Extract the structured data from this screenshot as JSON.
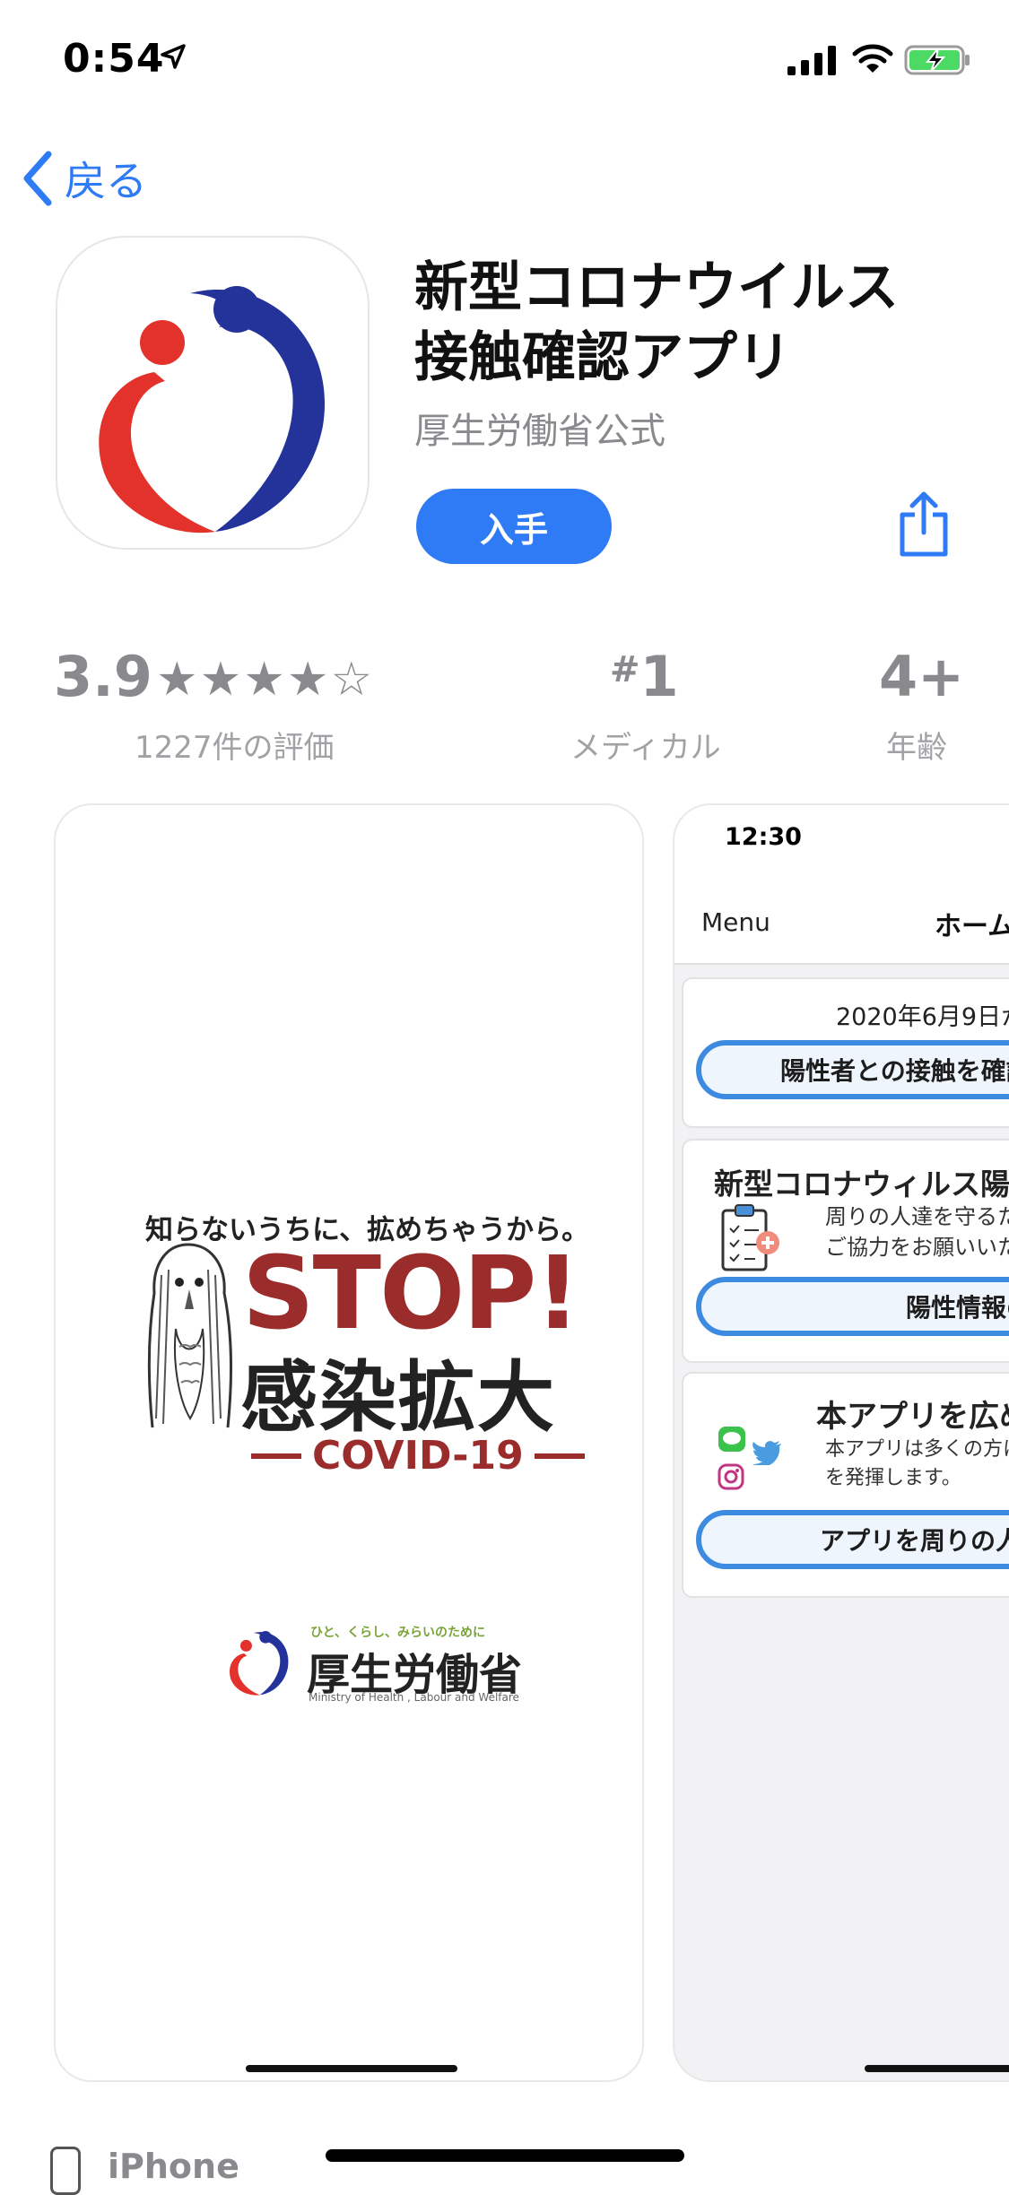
{
  "status_bar": {
    "time": "0:54",
    "icons": [
      "location-arrow-icon",
      "signal-bars-icon",
      "wifi-icon",
      "battery-charging-icon"
    ],
    "battery_color": "#4cd964"
  },
  "nav": {
    "back_label": "戻る"
  },
  "app": {
    "title_line1": "新型コロナウイルス",
    "title_line2": "接触確認アプリ",
    "subtitle": "厚生労働省公式",
    "get_label": "入手",
    "accent_color": "#2f7bf5"
  },
  "ratings": {
    "score": "3.9",
    "stars_display": "★★★★☆",
    "stars_value": 3.9,
    "count_label": "1227件の評価",
    "rank_hash": "#",
    "rank_value": "1",
    "rank_label": "メディカル",
    "age_value": "4+",
    "age_label": "年齢"
  },
  "screenshot1": {
    "tagline": "知らないうちに、拡めちゃうから。",
    "stop": "STOP!",
    "kanji": "感染拡大",
    "covid": "COVID-19",
    "org_tagline": "ひと、くらし、みらいのために",
    "org_name": "厚生労働省",
    "org_english": "Ministry of Health , Labour and Welfare"
  },
  "screenshot2": {
    "time": "12:30",
    "menu": "Menu",
    "home": "ホーム",
    "card1": {
      "date": "2020年6月9日か",
      "button": "陽性者との接触を確認"
    },
    "card2": {
      "title": "新型コロナウィルス陽性",
      "line1": "周りの人達を守るため",
      "line2": "ご協力をお願いいたし",
      "button": "陽性情報の"
    },
    "card3": {
      "title": "本アプリを広め",
      "line1": "本アプリは多くの方に",
      "line2": "を発揮します。",
      "button": "アプリを周りの人"
    }
  },
  "footer": {
    "device_label": "iPhone"
  }
}
